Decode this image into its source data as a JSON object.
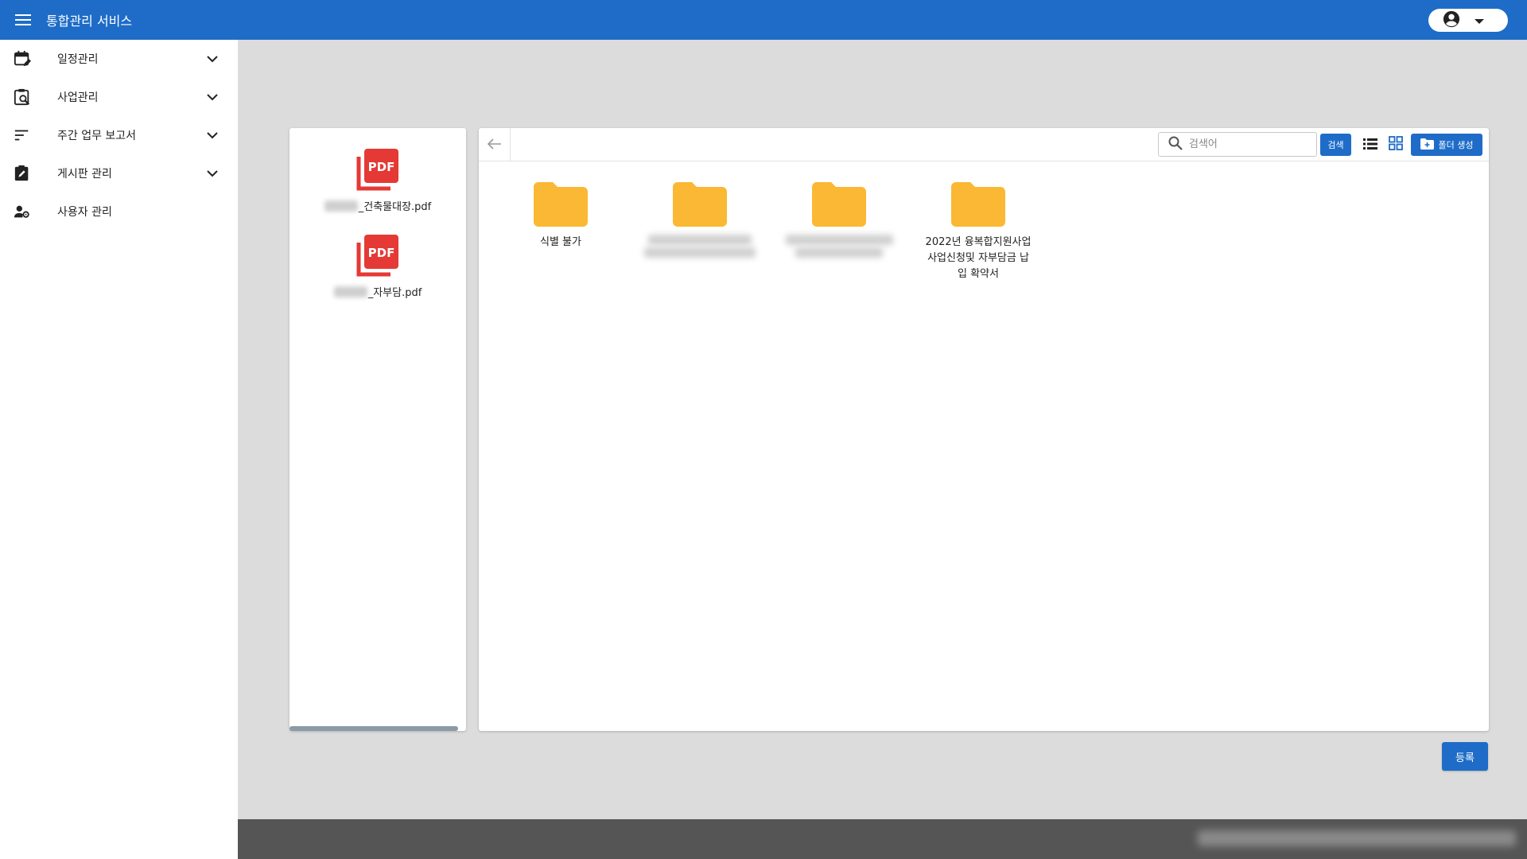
{
  "appbar": {
    "title": "통합관리 서비스",
    "menu_icon": "menu-icon",
    "account_icon": "account-circle-icon"
  },
  "sidebar": {
    "items": [
      {
        "label": "일정관리",
        "icon": "calendar-edit-icon",
        "expandable": true
      },
      {
        "label": "사업관리",
        "icon": "clipboard-search-icon",
        "expandable": true
      },
      {
        "label": "주간 업무 보고서",
        "icon": "sort-lines-icon",
        "expandable": true
      },
      {
        "label": "게시판 관리",
        "icon": "clipboard-edit-icon",
        "expandable": true
      },
      {
        "label": "사용자 관리",
        "icon": "user-settings-icon",
        "expandable": false
      }
    ]
  },
  "file_panel": {
    "files": [
      {
        "name_suffix": "_건축물대장.pdf",
        "icon": "pdf-icon"
      },
      {
        "name_suffix": "_자부담.pdf",
        "icon": "pdf-icon"
      }
    ]
  },
  "explorer": {
    "back_icon": "arrow-left-icon",
    "search_placeholder": "검색어",
    "search_button": "검색",
    "create_folder_button": "폴더 생성",
    "folders": [
      {
        "name_lines": [
          "식별 불가"
        ],
        "blurred": false
      },
      {
        "name_lines": [],
        "blurred": true
      },
      {
        "name_lines": [],
        "blurred": true
      },
      {
        "name_lines": [
          "2022년 융복합지원사업",
          "사업신청및 자부담금 납",
          "입 확약서"
        ],
        "blurred": false
      }
    ]
  },
  "actions": {
    "register_button": "등록"
  },
  "colors": {
    "primary": "#1e6cc8",
    "folder": "#fbb834",
    "pdf": "#e53935",
    "background": "#dcdcdc",
    "footer": "#555555"
  }
}
